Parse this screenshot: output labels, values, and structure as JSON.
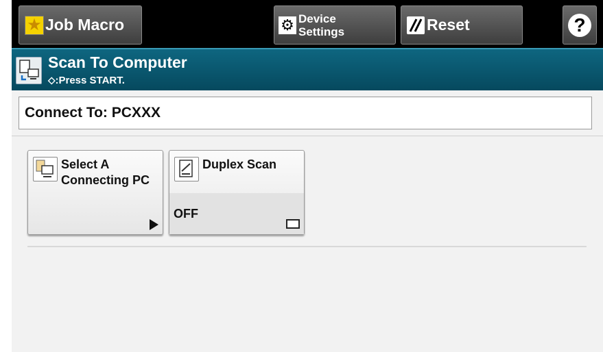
{
  "toolbar": {
    "job_macro_label": "Job Macro",
    "device_settings_line1": "Device",
    "device_settings_line2": "Settings",
    "reset_label": "Reset",
    "help_label": "?"
  },
  "title": {
    "text": "Scan To Computer",
    "subtitle": "⬦:Press START."
  },
  "connect": {
    "label": "Connect To: PCXXX"
  },
  "tiles": [
    {
      "label": "Select A Connecting PC",
      "value": ""
    },
    {
      "label": "Duplex Scan",
      "value": "OFF"
    }
  ],
  "icons": {
    "job_macro": "star-icon",
    "device_settings": "gear-icon",
    "reset": "reset-icon",
    "help": "help-icon"
  }
}
